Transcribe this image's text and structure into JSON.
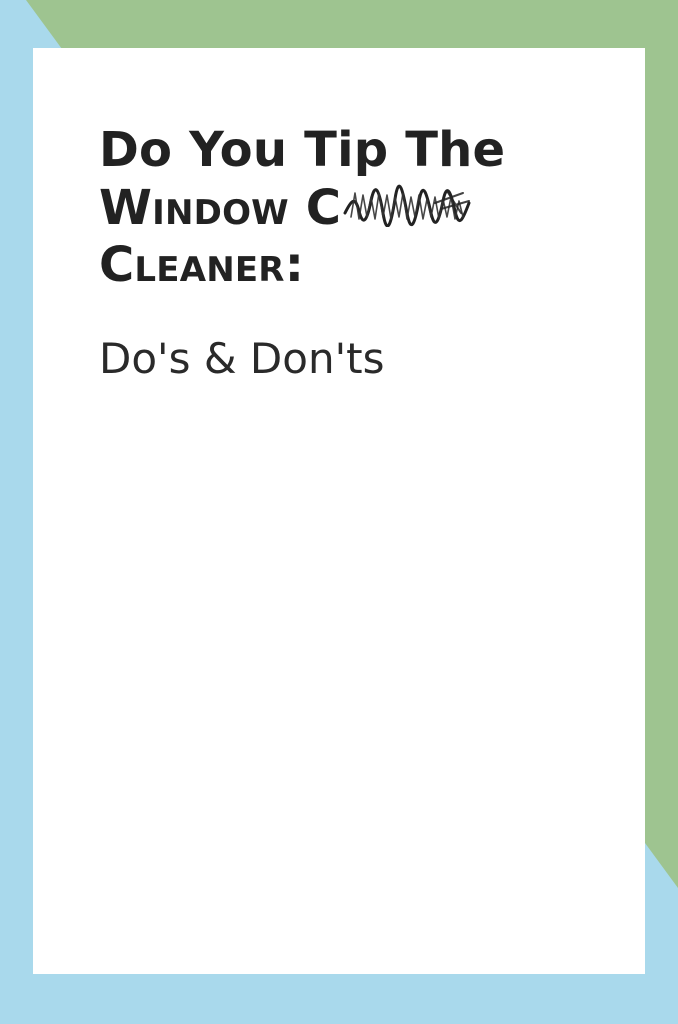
{
  "colors": {
    "background_blue": "#a9d9ec",
    "corner_green": "#9ec490",
    "card": "#ffffff",
    "text": "#222222"
  },
  "title": {
    "line1": "Do You Tip The",
    "line2": "Window C",
    "line3": "Cleaner:"
  },
  "subtitle": "Do's & Don'ts",
  "scribble_icon": "scribble-glyph"
}
